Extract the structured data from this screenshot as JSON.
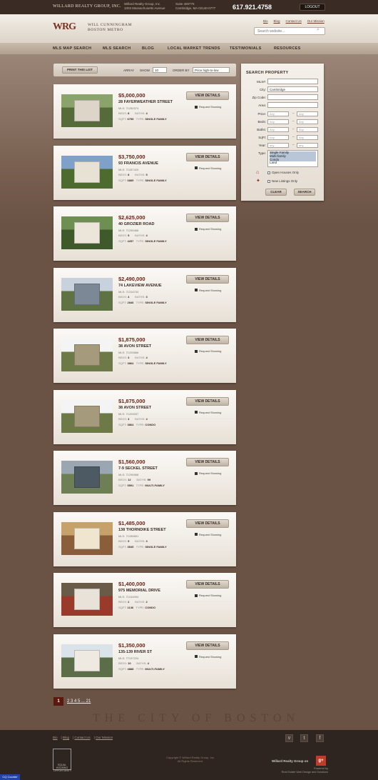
{
  "topbar": {
    "brand": "WILLARD REALTY GROUP, INC.",
    "addr1": "Willard Realty Group, Inc.\n1003 Massachusetts Avenue",
    "addr2": "Suite 400775\nCambridge, MA 02140-0777",
    "phone": "617.921.4758",
    "logout": "LOGOUT"
  },
  "header": {
    "logo": "WRG",
    "agent_line1": "WILL CUNNINGHAM",
    "agent_line2": "BOSTON METRO",
    "links": [
      "Bio",
      "Blog",
      "Contact Us",
      "Our Mission"
    ],
    "search_placeholder": "Search website..."
  },
  "nav": [
    "MLS MAP SEARCH",
    "MLS SEARCH",
    "BLOG",
    "LOCAL MARKET TRENDS",
    "TESTIMONIALS",
    "RESOURCES"
  ],
  "toolbar": {
    "print": "PRINT THIS LIST",
    "array": "ARRAY",
    "show": "SHOW",
    "show_value": "10",
    "order": "ORDER BY",
    "order_value": "Price high-to-low"
  },
  "listing_labels": {
    "view": "VIEW DETAILS",
    "request": "Request Showing",
    "beds": "BEDS:",
    "baths": "BATHS:",
    "sqft": "SQFT:",
    "type": "TYPE:"
  },
  "listings": [
    {
      "price": "$5,000,000",
      "street": "28 FAYERWEATHER STREET",
      "mls": "MLS: 71280374",
      "beds": "8",
      "baths": "4",
      "sqft": "6755",
      "type": "SINGLE FAMILY"
    },
    {
      "price": "$3,750,000",
      "street": "93 FRANCIS AVENUE",
      "mls": "MLS: 71287420",
      "beds": "8",
      "baths": "5",
      "sqft": "6885",
      "type": "SINGLE FAMILY"
    },
    {
      "price": "$2,625,000",
      "street": "40 GROZIER ROAD",
      "mls": "MLS: 71255466",
      "beds": "5",
      "baths": "4",
      "sqft": "4257",
      "type": "SINGLE FAMILY"
    },
    {
      "price": "$2,490,000",
      "street": "74 LAKEVIEW AVENUE",
      "mls": "MLS: 71316733",
      "beds": "4",
      "baths": "3",
      "sqft": "2846",
      "type": "SINGLE FAMILY"
    },
    {
      "price": "$1,875,000",
      "street": "38 AVON STREET",
      "mls": "MLS: 71209866",
      "beds": "3",
      "baths": "4",
      "sqft": "3864",
      "type": "SINGLE FAMILY"
    },
    {
      "price": "$1,875,000",
      "street": "38 AVON STREET",
      "mls": "MLS: 71209037",
      "beds": "3",
      "baths": "4",
      "sqft": "3864",
      "type": "CONDO"
    },
    {
      "price": "$1,560,000",
      "street": "7-9 SECKEL STREET",
      "mls": "MLS: 71296968",
      "beds": "12",
      "baths": "99",
      "sqft": "5591",
      "type": "MULTI-FAMILY"
    },
    {
      "price": "$1,485,000",
      "street": "138 THORNDIKE STREET",
      "mls": "MLS: 71285891",
      "beds": "5",
      "baths": "3",
      "sqft": "3545",
      "type": "SINGLE FAMILY"
    },
    {
      "price": "$1,400,000",
      "street": "975 MEMORIAL DRIVE",
      "mls": "MLS: 71244094",
      "beds": "2",
      "baths": "2",
      "sqft": "1136",
      "type": "CONDO"
    },
    {
      "price": "$1,350,000",
      "street": "135-139 RIVER ST",
      "mls": "MLS: 77137224",
      "beds": "10",
      "baths": "4",
      "sqft": "4888",
      "type": "MULTI-FAMILY"
    }
  ],
  "panel": {
    "title": "SEARCH PROPERTY",
    "mls": "MLS#:",
    "city": "City:",
    "city_value": "Cambridge",
    "zip": "Zip Code:",
    "area": "Area:",
    "price": "Price:",
    "beds": "Beds:",
    "baths": "Baths:",
    "sqft": "SqFt:",
    "year": "Year:",
    "type": "Type:",
    "any": "Any",
    "anyl": "any",
    "types": [
      "Single Family",
      "Multi-family",
      "Condo",
      "Land"
    ],
    "open_houses": "Open Houses Only",
    "new_listings": "New Listings Only",
    "clear": "CLEAR",
    "search": "SEARCH"
  },
  "pager": {
    "current": "1",
    "others": "2 3 4 5 ... 21"
  },
  "watermark": "THE CITY OF BOSTON",
  "footer": {
    "links": [
      "Bio",
      "Blog",
      "Contact Us",
      "Our Mission"
    ],
    "eho": "EQUAL HOUSING OPPORTUNITY",
    "copyright": "Copyright © Willard Realty Group, Inc.\nAll Rights Reserved.",
    "wrg": "Willard Realty Group on",
    "powered": "Powered by\nReal Estate Web Design and Solutions"
  },
  "counter": "CQ Counter"
}
